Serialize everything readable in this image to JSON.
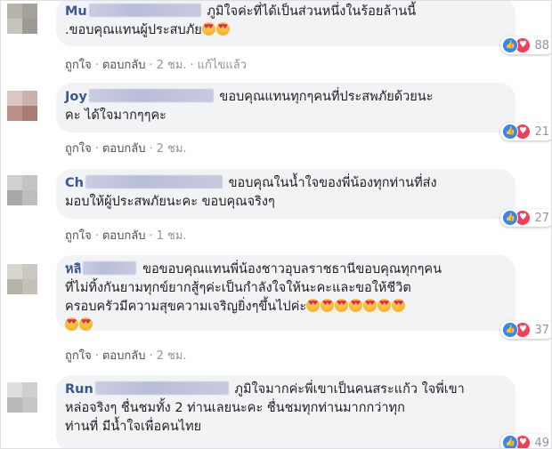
{
  "comments": [
    {
      "author_visible": "Mu",
      "lines": [
        "ภูมิใจค่ะที่ได้เป็นส่วนหนึ่งในร้อยล้านนี้",
        ".ขอบคุณแทนผู้ประสบภัย"
      ],
      "reaction_count": "88",
      "like": "ถูกใจ",
      "reply": "ตอบกลับ",
      "time": "2 ชม.",
      "edited": "แก้ไขแล้ว"
    },
    {
      "author_visible": "Joy",
      "lines": [
        "ขอบคุณแทนทุกๆคนที่ประสพภัยด้วยนะ",
        "คะ ได้ใจมากๆๆคะ"
      ],
      "reaction_count": "21",
      "like": "ถูกใจ",
      "reply": "ตอบกลับ",
      "time": "2 ชม."
    },
    {
      "author_visible": "Ch",
      "lines": [
        "ขอบคุณในน้ำใจของพี่น้องทุกท่านที่ส่ง",
        "มอบให้ผู้ประสพภัยนะคะ ขอบคุณจริงๆ"
      ],
      "reaction_count": "27",
      "like": "ถูกใจ",
      "reply": "ตอบกลับ",
      "time": "1 ชม."
    },
    {
      "author_visible": "หลิ",
      "lines": [
        "ขอขอบคุณแทนพี่น้องชาวอุบลราชธานีขอบคุณทุกๆคน",
        "ที่ไม่ทิ้งกันยามทุกข์ยากสู้ๆค่ะเป็นกำลังใจให้นะคะและขอให้ชีวิต",
        "ครอบครัวมีความสุขความเจริญยิ่งๆขึ้นไปค่ะ"
      ],
      "reaction_count": "37",
      "like": "ถูกใจ",
      "reply": "ตอบกลับ",
      "time": "2 ชม."
    },
    {
      "author_visible": "Run",
      "lines": [
        "ภูมิใจมากค่ะพี่เขาเป็นคนสระแก้ว ใจพี่เขา",
        "หล่อจริงๆ ชื่นชมทั้ง 2 ท่านเลยนะคะ ชื่นชมทุกท่านมากกว่าทุก",
        "ท่านที่ มีน้ำใจเพื่อคนไทย"
      ],
      "reaction_count": "49"
    }
  ],
  "colors": {
    "name": "#385898",
    "bubble": "#f2f3f5",
    "like": "#2d88ff",
    "love": "#f33e58"
  },
  "icons": [
    "like-icon",
    "love-icon",
    "heart-eyes-emoji"
  ]
}
